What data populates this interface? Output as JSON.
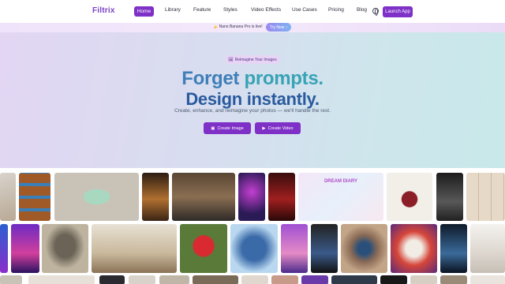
{
  "nav": {
    "logo": "Filtrix",
    "home": "Home",
    "items": [
      "Library",
      "Feature",
      "Styles",
      "Video Effects",
      "Use Cases",
      "Pricing",
      "Blog"
    ],
    "launch": "Launch App"
  },
  "announce": {
    "text": "🍌 Nano Banana Pro is live!",
    "cta": "Try Now",
    "cta_arrow": "›"
  },
  "hero": {
    "badge_icon": "🖼",
    "badge": "Reimagine Your Images",
    "title_part1": "Forget ",
    "title_part2": "prompts.",
    "title_line2": "Design instantly.",
    "subtitle": "Create, enhance, and reimagine your photos — we'll handle the rest.",
    "btn_image_icon": "▣",
    "btn_image": "Create Image",
    "btn_video_icon": "▶",
    "btn_video": "Create Video"
  },
  "gallery": {
    "dream_diary": "DREAM DIARY"
  },
  "colors": {
    "accent": "#7e30c7",
    "title_blue": "#3f7fb8",
    "title_teal": "#37a3b4"
  }
}
